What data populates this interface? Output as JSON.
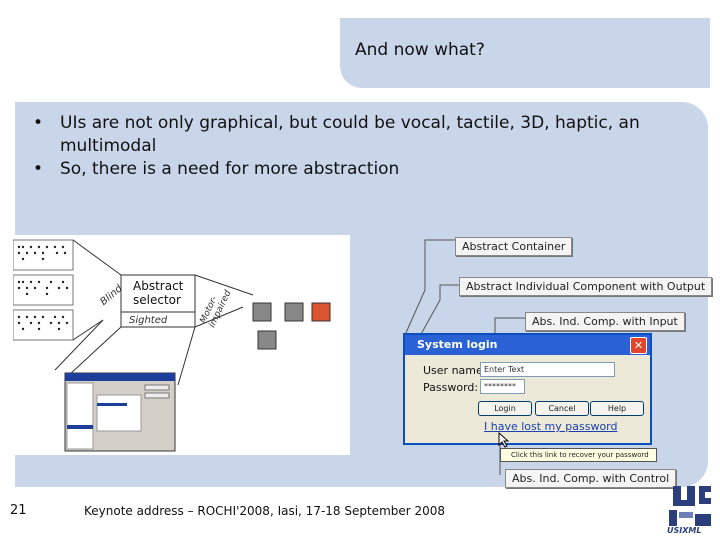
{
  "slide": {
    "title": "And now what?",
    "bullets": [
      "UIs are not only graphical, but could be vocal, tactile, 3D, haptic, an multimodal",
      "So, there is a need for more abstraction"
    ],
    "bullet_glyph": "•",
    "page_number": "21",
    "footer": "Keynote address – ROCHI'2008, Iasi, 17-18 September 2008",
    "colors": {
      "panel": "#c9d6ea",
      "text": "#111111"
    }
  },
  "illustration": {
    "abstract_selector": "Abstract\nselector",
    "label_blind": "Blind",
    "label_sighted": "Sighted",
    "label_motor": "Motor-\nimpaired"
  },
  "callouts": {
    "container": "Abstract Container",
    "individual_output": "Abstract Individual Component with Output",
    "input": "Abs. Ind. Comp. with Input",
    "control": "Abs. Ind. Comp. with Control"
  },
  "dialog": {
    "title": "System login",
    "close_glyph": "✕",
    "user_label": "User name:",
    "user_value": "Enter Text",
    "password_label": "Password:",
    "password_value": "********",
    "login_label": "Login",
    "cancel_label": "Cancel",
    "help_label": "Help",
    "link_text": "I have lost my password",
    "tooltip_text": "Click this link to recover your password"
  },
  "logo": {
    "top": "US",
    "bottom": "XML",
    "caption": "USIXML"
  }
}
